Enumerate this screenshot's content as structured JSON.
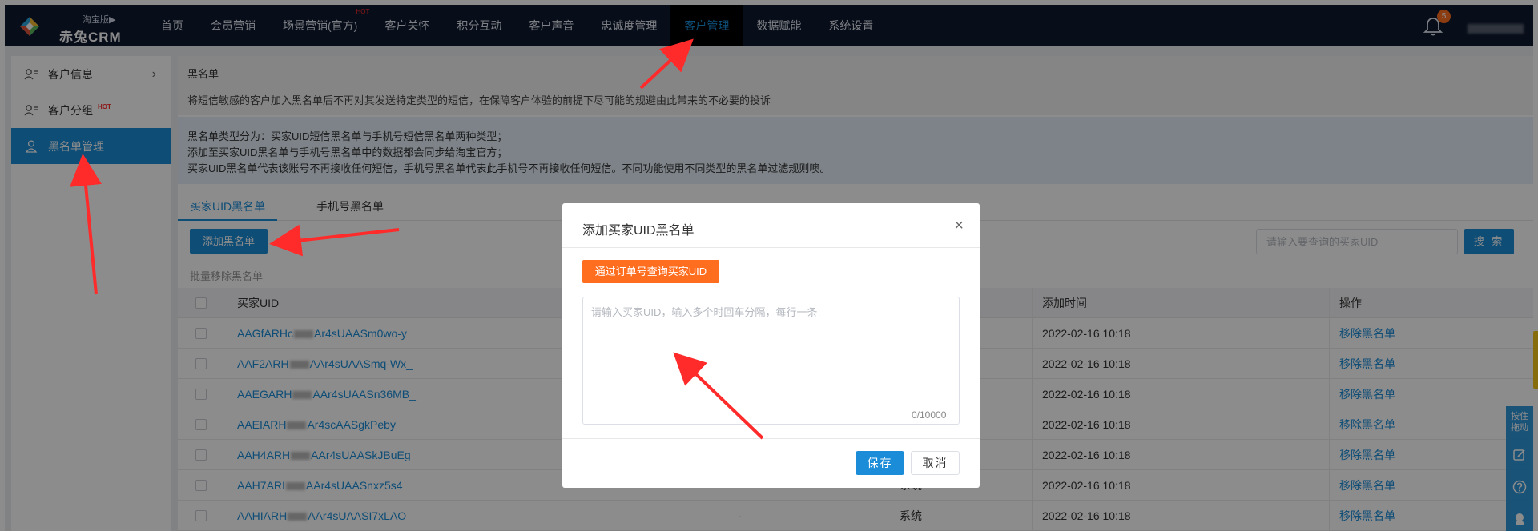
{
  "app": {
    "edition": "淘宝版",
    "edition_caret": "▶",
    "brand": "赤兔CRM",
    "brand_colors": {
      "primary": "#1a8cd8",
      "dark": "#0f1a2e",
      "orange": "#ff6d1f",
      "hot": "#ff2b2b"
    }
  },
  "nav": {
    "items": [
      {
        "label": "首页"
      },
      {
        "label": "会员营销"
      },
      {
        "label": "场景营销(官方)",
        "badge": "HOT"
      },
      {
        "label": "客户关怀"
      },
      {
        "label": "积分互动"
      },
      {
        "label": "客户声音"
      },
      {
        "label": "忠诚度管理"
      },
      {
        "label": "客户管理",
        "active": true
      },
      {
        "label": "数据赋能"
      },
      {
        "label": "系统设置"
      }
    ],
    "notification_count": "5"
  },
  "sidebar": {
    "items": [
      {
        "label": "客户信息",
        "icon": "user-list-icon",
        "arrow": "›"
      },
      {
        "label": "客户分组",
        "icon": "user-group-icon",
        "badge": "HOT"
      },
      {
        "label": "黑名单管理",
        "icon": "user-icon",
        "active": true
      }
    ]
  },
  "page": {
    "title": "黑名单",
    "description": "将短信敏感的客户加入黑名单后不再对其发送特定类型的短信，在保障客户体验的前提下尽可能的规避由此带来的不必要的投诉",
    "info_lines": [
      "黑名单类型分为：买家UID短信黑名单与手机号短信黑名单两种类型；",
      "添加至买家UID黑名单与手机号黑名单中的数据都会同步给淘宝官方；",
      "买家UID黑名单代表该账号不再接收任何短信，手机号黑名单代表此手机号不再接收任何短信。不同功能使用不同类型的黑名单过滤规则噢。"
    ],
    "tabs": [
      {
        "label": "买家UID黑名单",
        "active": true
      },
      {
        "label": "手机号黑名单"
      }
    ],
    "add_button": "添加黑名单",
    "search_placeholder": "请输入要查询的买家UID",
    "search_button": "搜 索",
    "bulk_remove": "批量移除黑名单"
  },
  "table": {
    "columns": [
      "买家UID",
      "添加时间",
      "操作"
    ],
    "rows": [
      {
        "uid_prefix": "AAGfARHc",
        "uid_suffix": "Ar4sUAASm0wo-y",
        "source": "",
        "time": "2022-02-16 10:18",
        "action": "移除黑名单"
      },
      {
        "uid_prefix": "AAF2ARH",
        "uid_suffix": "AAr4sUAASmq-Wx_",
        "source": "",
        "time": "2022-02-16 10:18",
        "action": "移除黑名单"
      },
      {
        "uid_prefix": "AAEGARH",
        "uid_suffix": "AAr4sUAASn36MB_",
        "source": "",
        "time": "2022-02-16 10:18",
        "action": "移除黑名单"
      },
      {
        "uid_prefix": "AAEIARH",
        "uid_suffix": "Ar4scAASgkPeby",
        "source": "",
        "time": "2022-02-16 10:18",
        "action": "移除黑名单"
      },
      {
        "uid_prefix": "AAH4ARH",
        "uid_suffix": "AAr4sUAASkJBuEg",
        "source": "",
        "time": "2022-02-16 10:18",
        "action": "移除黑名单"
      },
      {
        "uid_prefix": "AAH7ARI",
        "uid_suffix": "AAr4sUAASnxz5s4",
        "source": "系统",
        "time": "2022-02-16 10:18",
        "action": "移除黑名单"
      },
      {
        "uid_prefix": "AAHIARH",
        "uid_suffix": "AAr4sUAASI7xLAO",
        "dash": "-",
        "source": "系统",
        "time": "2022-02-16 10:18",
        "action": "移除黑名单"
      }
    ]
  },
  "modal": {
    "title": "添加买家UID黑名单",
    "close": "×",
    "query_button": "通过订单号查询买家UID",
    "textarea_placeholder": "请输入买家UID，输入多个时回车分隔，每行一条",
    "textarea_value": "",
    "counter": "0/10000",
    "save": "保存",
    "cancel": "取消"
  },
  "float_bar": {
    "drag_label": "按住拖动",
    "icons": [
      "edit-icon",
      "help-icon",
      "service-icon"
    ]
  }
}
